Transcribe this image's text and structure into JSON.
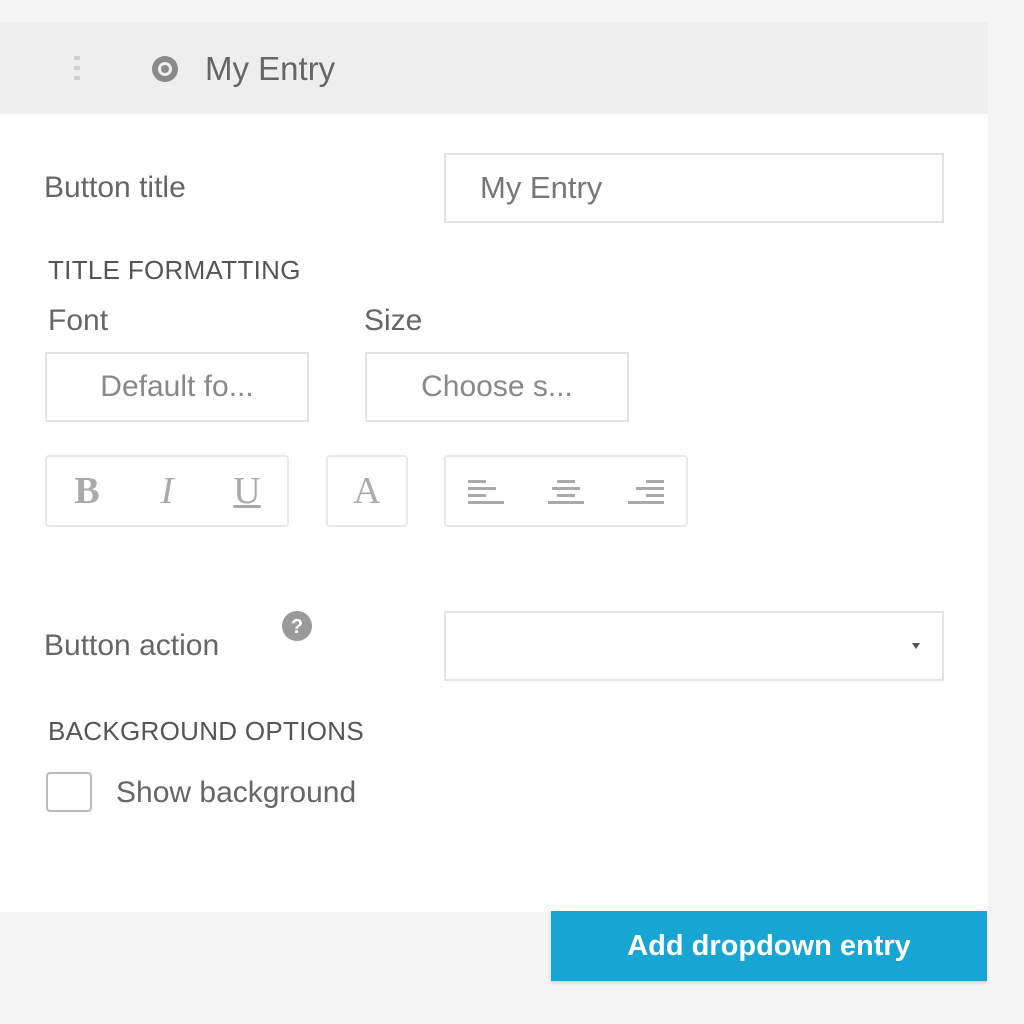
{
  "header": {
    "title": "My Entry",
    "drag_icon": "drag-handle-icon",
    "entry_icon": "settings-icon"
  },
  "button_title": {
    "label": "Button title",
    "value": "My Entry"
  },
  "title_formatting": {
    "heading": "TITLE FORMATTING",
    "font_label": "Font",
    "font_value": "Default fo...",
    "size_label": "Size",
    "size_value": "Choose s...",
    "bold_label": "B",
    "italic_label": "I",
    "underline_label": "U",
    "color_label": "A",
    "align_icons": [
      "align-left-icon",
      "align-center-icon",
      "align-right-icon"
    ]
  },
  "button_action": {
    "label": "Button action",
    "value": "",
    "help_icon": "help-icon"
  },
  "background_options": {
    "heading": "BACKGROUND OPTIONS",
    "show_background_label": "Show background",
    "show_background_checked": false
  },
  "footer": {
    "add_button_label": "Add dropdown entry"
  },
  "colors": {
    "accent": "#17a5d3",
    "header_bg": "#eeeeee",
    "page_bg": "#f5f5f5"
  }
}
